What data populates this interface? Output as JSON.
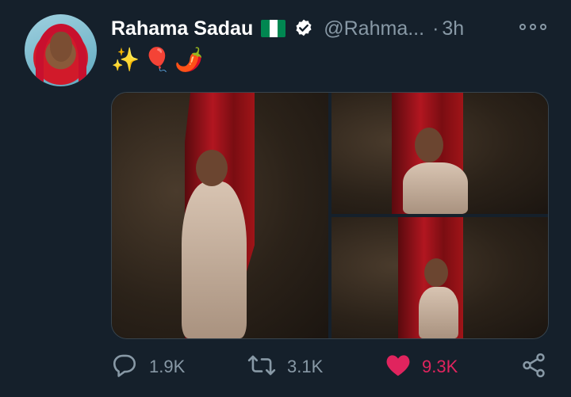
{
  "tweet": {
    "author_name": "Rahama Sadau",
    "handle": "@Rahma...",
    "separator": "·",
    "time": "3h",
    "flag": "nigeria-flag",
    "verified_icon": "verified-badge-icon",
    "text_emojis": "✨🎈🌶️",
    "media_count": 3
  },
  "actions": {
    "replies": "1.9K",
    "retweets": "3.1K",
    "likes": "9.3K"
  },
  "colors": {
    "background": "#15202b",
    "secondary_text": "#8899a6",
    "like_active": "#e0245e",
    "flag_green": "#008751"
  }
}
